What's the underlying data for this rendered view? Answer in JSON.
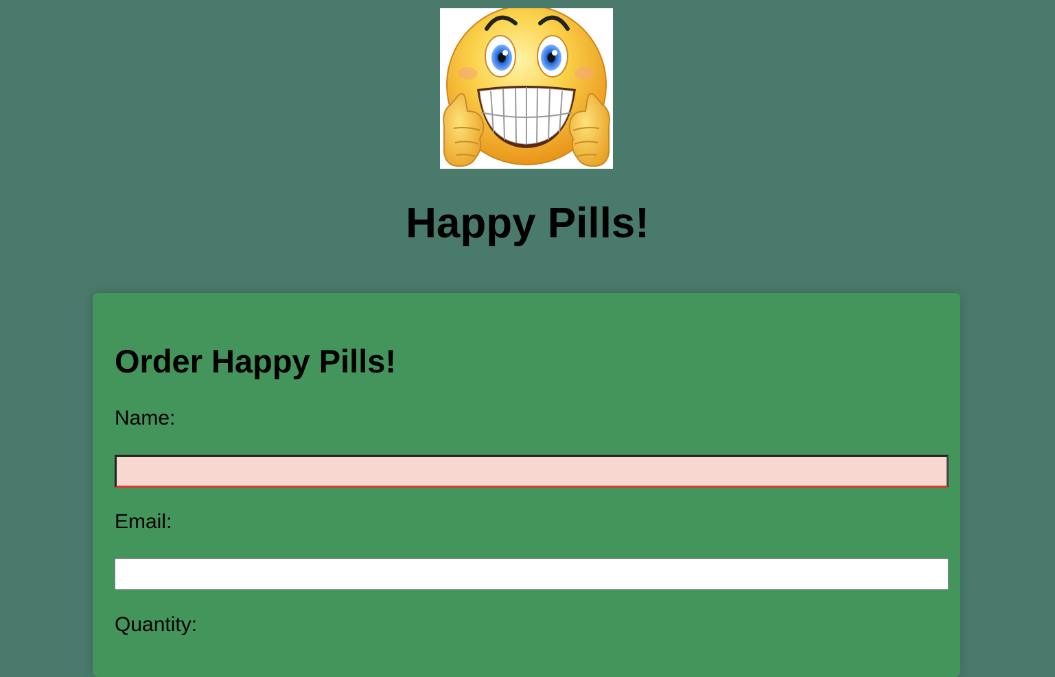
{
  "header": {
    "logo_icon": "smiley-thumbs-up-icon",
    "title": "Happy Pills!"
  },
  "order_form": {
    "title": "Order Happy Pills!",
    "name": {
      "label": "Name:",
      "value": ""
    },
    "email": {
      "label": "Email:",
      "value": ""
    },
    "quantity": {
      "label": "Quantity:"
    }
  },
  "colors": {
    "page_background": "#4a7a6c",
    "card_background": "#43955b",
    "invalid_input_background": "#f7d7d0",
    "invalid_input_border": "#d63a2e"
  }
}
